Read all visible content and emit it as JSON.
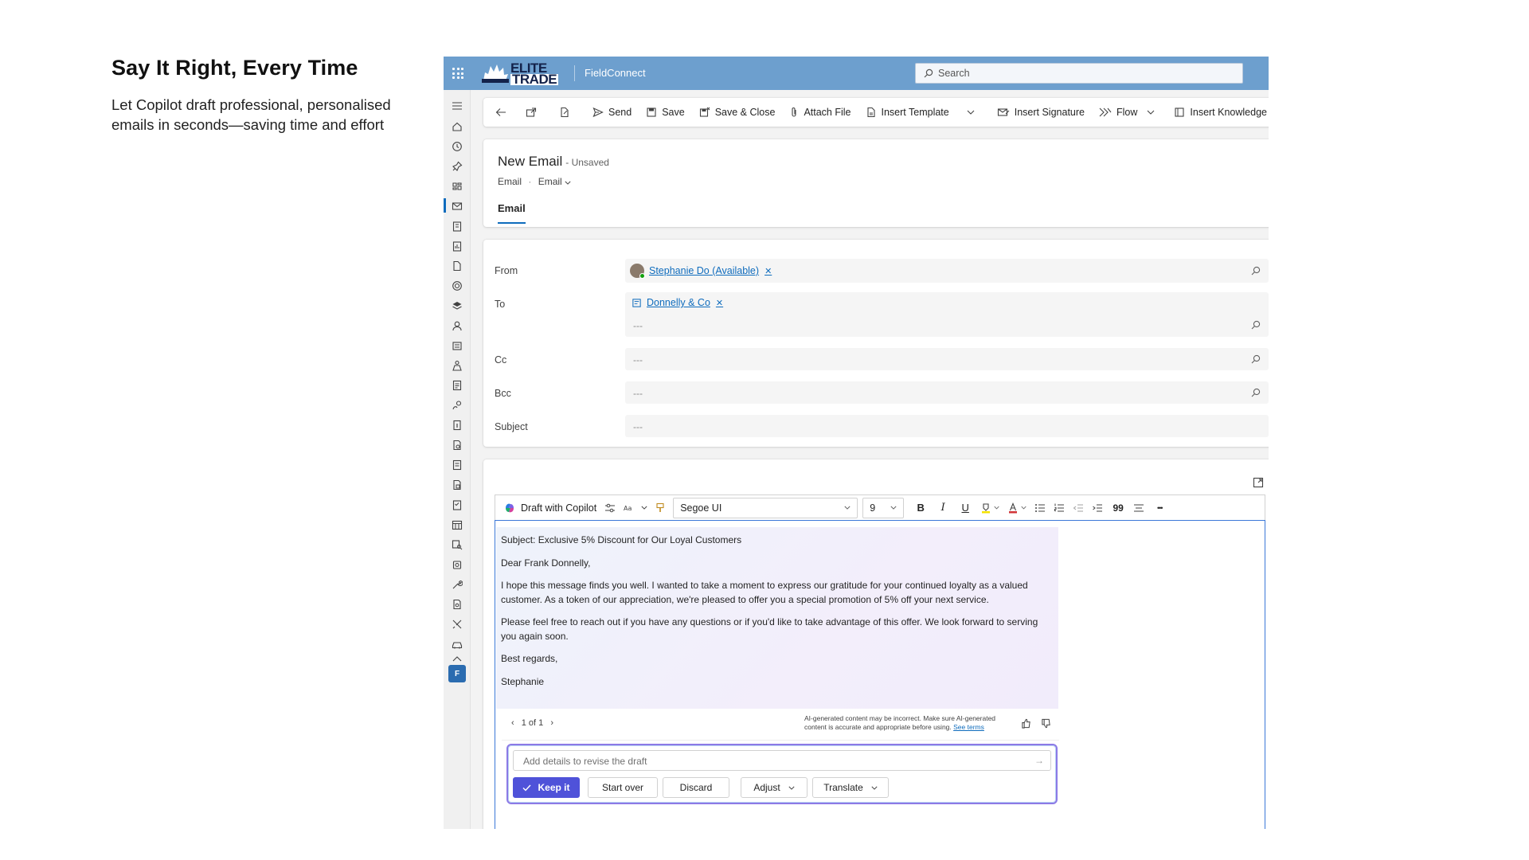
{
  "caption": {
    "title": "Say It Right, Every Time",
    "body": "Let Copilot draft professional, personalised emails in seconds—saving time and effort"
  },
  "topbar": {
    "logo_line1": "ELITE",
    "logo_line2": "TRADE",
    "app_name": "FieldConnect",
    "search_placeholder": "Search"
  },
  "commands": {
    "send": "Send",
    "save": "Save",
    "save_close": "Save & Close",
    "attach": "Attach File",
    "insert_template": "Insert Template",
    "insert_signature": "Insert Signature",
    "flow": "Flow",
    "insert_knowledge": "Insert Knowledge A"
  },
  "header": {
    "title": "New Email",
    "status": "- Unsaved",
    "entity": "Email",
    "form": "Email",
    "tab": "Email"
  },
  "fields": {
    "from_label": "From",
    "from_value": "Stephanie Do (Available)",
    "to_label": "To",
    "to_value": "Donnelly & Co",
    "cc_label": "Cc",
    "bcc_label": "Bcc",
    "subject_label": "Subject",
    "empty": "---"
  },
  "toolbar": {
    "copilot": "Draft with Copilot",
    "font": "Segoe UI",
    "size": "9",
    "bold": "B",
    "italic": "I",
    "underline": "U",
    "quote": "99",
    "more": "•••"
  },
  "draft": {
    "subject": "Subject: Exclusive 5% Discount for Our Loyal Customers",
    "greeting": "Dear Frank Donnelly,",
    "para1": "I hope this message finds you well. I wanted to take a moment to express our gratitude for your continued loyalty as a valued customer. As a token of our appreciation, we're pleased to offer you a special promotion of 5% off your next service.",
    "para2": "Please feel free to reach out if you have any questions or if you'd like to take advantage of this offer. We look forward to serving you again soon.",
    "closing": "Best regards,",
    "signature": "Stephanie"
  },
  "ai": {
    "pager": "1 of 1",
    "disclaimer": "AI-generated content may be incorrect. Make sure AI-generated content is accurate and appropriate before using.",
    "see_terms": "See terms",
    "revise_placeholder": "Add details to revise the draft",
    "keep": "Keep it",
    "start_over": "Start over",
    "discard": "Discard",
    "adjust": "Adjust",
    "translate": "Translate"
  },
  "user": {
    "initial": "F"
  },
  "colors": {
    "topbar": "#6d9fce",
    "accent": "#0f6cbd",
    "keep_button": "#4f52d9",
    "revise_border": "#8c7ae6"
  }
}
